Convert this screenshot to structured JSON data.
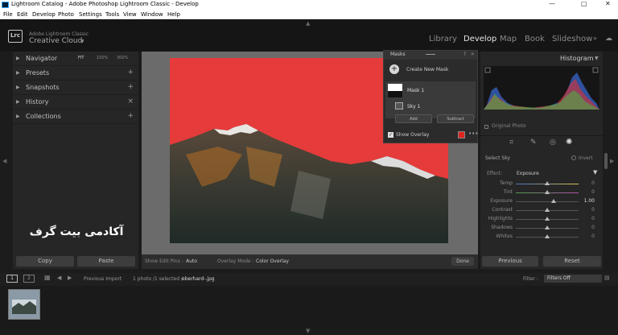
{
  "window": {
    "title": "Lightroom Catalog - Adobe Photoshop Lightroom Classic - Develop",
    "minimize": "—",
    "maximize": "▢",
    "close": "✕"
  },
  "menu": [
    "File",
    "Edit",
    "Develop",
    "Photo",
    "Settings",
    "Tools",
    "View",
    "Window",
    "Help"
  ],
  "identity": {
    "logo": "Lrc",
    "line1": "Adobe Lightroom Classic",
    "line2": "Creative Cloud"
  },
  "modules": [
    "Library",
    "Develop",
    "Map",
    "Book",
    "Slideshow"
  ],
  "left_panel": {
    "navigator": {
      "label": "Navigator",
      "zoom": [
        "FIT",
        "100%",
        "300%"
      ]
    },
    "rows": [
      {
        "label": "Presets",
        "action": "+"
      },
      {
        "label": "Snapshots",
        "action": "+"
      },
      {
        "label": "History",
        "action": "×"
      },
      {
        "label": "Collections",
        "action": "+"
      }
    ],
    "copy": "Copy",
    "paste": "Paste"
  },
  "watermark": "آکادمی بیت گرف",
  "masks_panel": {
    "title": "Masks",
    "create": "Create New Mask",
    "mask_name": "Mask 1",
    "component": "Sky 1",
    "add": "Add",
    "subtract": "Subtract",
    "show_overlay": "Show Overlay",
    "overlay_color": "#e0241e"
  },
  "right_panel": {
    "histogram": "Histogram",
    "original_photo": "Original Photo",
    "select_label": "Select Sky",
    "invert": "Invert",
    "effect_label": "Effect:",
    "effect_value": "Exposure",
    "sliders": [
      {
        "name": "Temp",
        "value": "0",
        "pos": 0.5
      },
      {
        "name": "Tint",
        "value": "0",
        "pos": 0.5
      },
      {
        "name": "Exposure",
        "value": "1.00",
        "pos": 0.6
      },
      {
        "name": "Contrast",
        "value": "0",
        "pos": 0.5
      },
      {
        "name": "Highlights",
        "value": "0",
        "pos": 0.5
      },
      {
        "name": "Shadows",
        "value": "0",
        "pos": 0.5
      },
      {
        "name": "Whites",
        "value": "0",
        "pos": 0.5
      }
    ],
    "previous": "Previous",
    "reset": "Reset"
  },
  "toolbar": {
    "show_edit_pins": "Show Edit Pins :",
    "pins_value": "Auto",
    "overlay_mode": "Overlay Mode :",
    "overlay_value": "Color Overlay",
    "done": "Done"
  },
  "filmstrip": {
    "screen1": "1",
    "screen2": "2",
    "source": "Previous Import",
    "info": "1 photo /1 selected /",
    "filename": "eberhard-.jpg",
    "filter_label": "Filter :",
    "filter_value": "Filters Off"
  }
}
